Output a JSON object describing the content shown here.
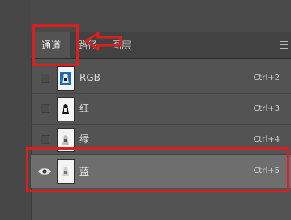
{
  "tabs": [
    {
      "label": "通道",
      "active": true
    },
    {
      "label": "路径",
      "active": false
    },
    {
      "label": "图层",
      "active": false
    }
  ],
  "channels": [
    {
      "name": "RGB",
      "shortcut": "Ctrl+2",
      "thumb": "rgb",
      "visible": false,
      "selected": false
    },
    {
      "name": "红",
      "shortcut": "Ctrl+3",
      "thumb": "gray",
      "visible": false,
      "selected": false
    },
    {
      "name": "绿",
      "shortcut": "Ctrl+4",
      "thumb": "gray",
      "visible": false,
      "selected": false
    },
    {
      "name": "蓝",
      "shortcut": "Ctrl+5",
      "thumb": "gray",
      "visible": true,
      "selected": true
    }
  ],
  "colors": {
    "panel_bg": "#535353",
    "selected_row": "#6e6e6e",
    "highlight": "#d82020"
  },
  "icons": {
    "visibility": "eye-icon",
    "panel_menu": "menu-icon",
    "annotation": "arrow-icon"
  }
}
